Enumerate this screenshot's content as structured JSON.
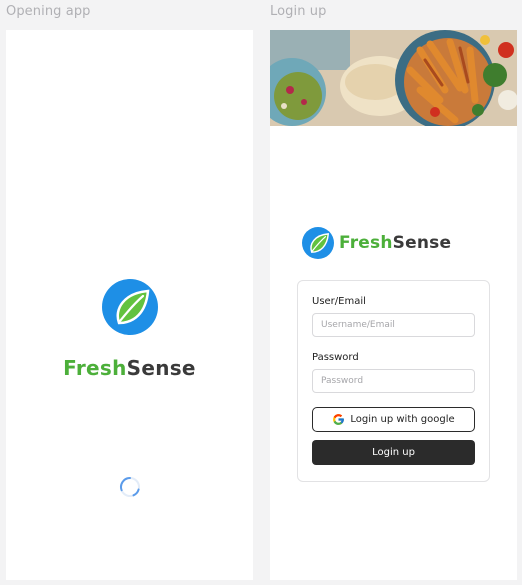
{
  "frames": {
    "opening": {
      "title": "Opening app"
    },
    "login": {
      "title": "Login up"
    }
  },
  "brand": {
    "part1": "Fresh",
    "part2": "Sense",
    "green": "#4caf3a",
    "dark": "#3a3a3a",
    "logo_blue": "#1e8fe6"
  },
  "login_form": {
    "user_label": "User/Email",
    "user_placeholder": "Username/Email",
    "password_label": "Password",
    "password_placeholder": "Password",
    "google_button": "Login up with google",
    "submit_button": "Login up"
  },
  "icons": {
    "logo": "leaf-logo-icon",
    "spinner": "loading-spinner-icon",
    "google": "google-icon",
    "hero": "food-photo"
  }
}
